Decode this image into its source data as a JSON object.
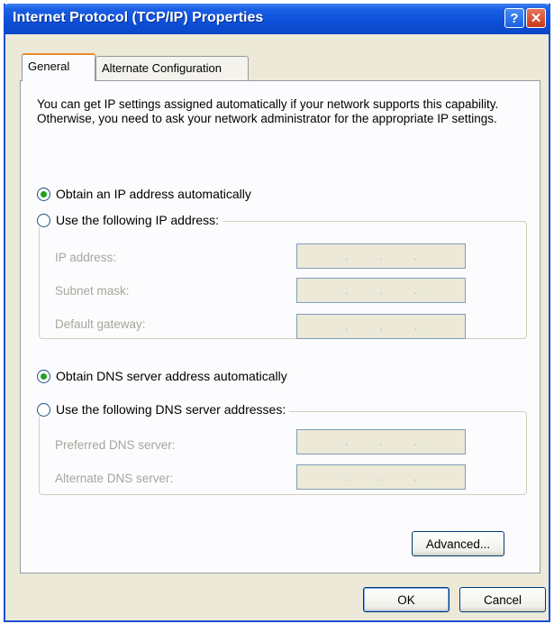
{
  "window": {
    "title": "Internet Protocol (TCP/IP) Properties",
    "help_label": "?",
    "close_label": "✕"
  },
  "tabs": [
    {
      "label": "General",
      "selected": true
    },
    {
      "label": "Alternate Configuration",
      "selected": false
    }
  ],
  "general": {
    "description": "You can get IP settings assigned automatically if your network supports this capability. Otherwise, you need to ask your network administrator for the appropriate IP settings.",
    "ip": {
      "auto_label": "Obtain an IP address automatically",
      "auto_selected": true,
      "manual_label": "Use the following IP address:",
      "manual_selected": false,
      "fields": [
        {
          "label": "IP address:",
          "value": ""
        },
        {
          "label": "Subnet mask:",
          "value": ""
        },
        {
          "label": "Default gateway:",
          "value": ""
        }
      ]
    },
    "dns": {
      "auto_label": "Obtain DNS server address automatically",
      "auto_selected": true,
      "manual_label": "Use the following DNS server addresses:",
      "manual_selected": false,
      "fields": [
        {
          "label": "Preferred DNS server:",
          "value": ""
        },
        {
          "label": "Alternate DNS server:",
          "value": ""
        }
      ]
    },
    "advanced_label": "Advanced..."
  },
  "footer": {
    "ok_label": "OK",
    "cancel_label": "Cancel"
  },
  "colors": {
    "title_bar": "#0c4fd8",
    "dialog_bg": "#ece9d8",
    "radio_dot": "#21a121",
    "disabled_text": "#a6a59c"
  }
}
